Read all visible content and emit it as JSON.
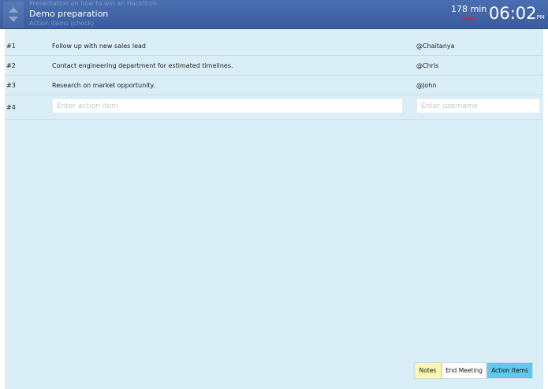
{
  "header": {
    "prev_topic": "Presentation on how to win an Hackthon",
    "current_topic": "Demo preparation",
    "next_topic": "Action Items (check)",
    "timer_minutes": "178 min",
    "timer_status": "over",
    "clock_time": "06:02",
    "clock_ampm": "PM",
    "colors": {
      "header_bg": "#3f63a5",
      "over_text": "#d0223a"
    }
  },
  "action_items": [
    {
      "num": "#1",
      "item": "Follow up with new sales lead",
      "user": "@Chaitanya"
    },
    {
      "num": "#2",
      "item": "Contact engineering department for estimated timelines.",
      "user": "@Chris"
    },
    {
      "num": "#3",
      "item": "Research on market opportunity.",
      "user": "@John"
    }
  ],
  "new_item": {
    "num": "#4",
    "item_placeholder": "Enter action item",
    "user_placeholder": "Enter username"
  },
  "footer": {
    "notes_label": "Notes",
    "end_meeting_label": "End Meeting",
    "action_items_label": "Action Items",
    "colors": {
      "notes_bg": "#fbf7b0",
      "action_items_bg": "#5fc8ee"
    }
  }
}
